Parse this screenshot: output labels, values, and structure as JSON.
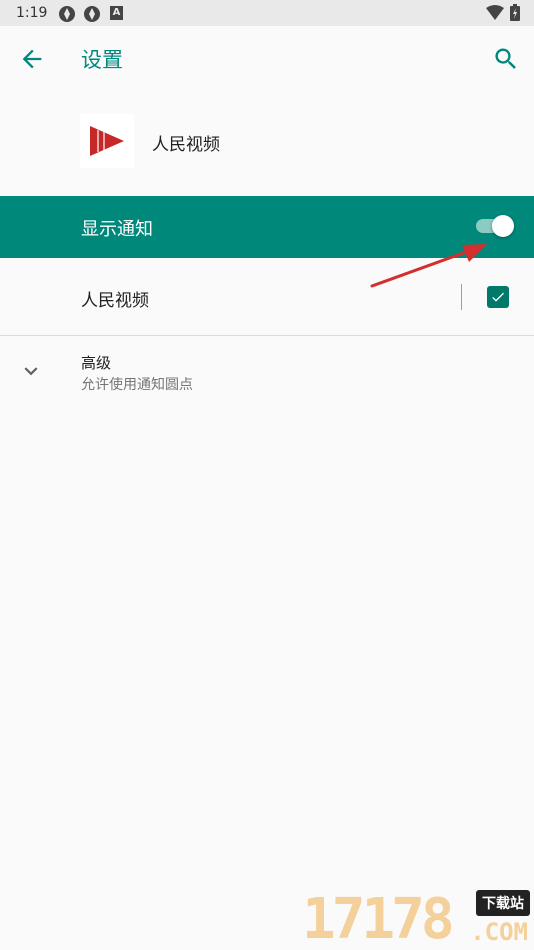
{
  "status_bar": {
    "time": "1:19",
    "a_badge": "A"
  },
  "app_bar": {
    "title": "设置"
  },
  "app_header": {
    "app_name": "人民视频"
  },
  "master_toggle": {
    "label": "显示通知",
    "state": "on"
  },
  "channel": {
    "label": "人民视频",
    "checked": true
  },
  "advanced": {
    "title": "高级",
    "summary": "允许使用通知圆点"
  },
  "watermark": {
    "digits": "17178",
    "tag": "下载站",
    "suffix": ".COM"
  },
  "colors": {
    "accent": "#00897b",
    "annotation_arrow": "#d32f2f",
    "logo_red": "#c62828"
  }
}
